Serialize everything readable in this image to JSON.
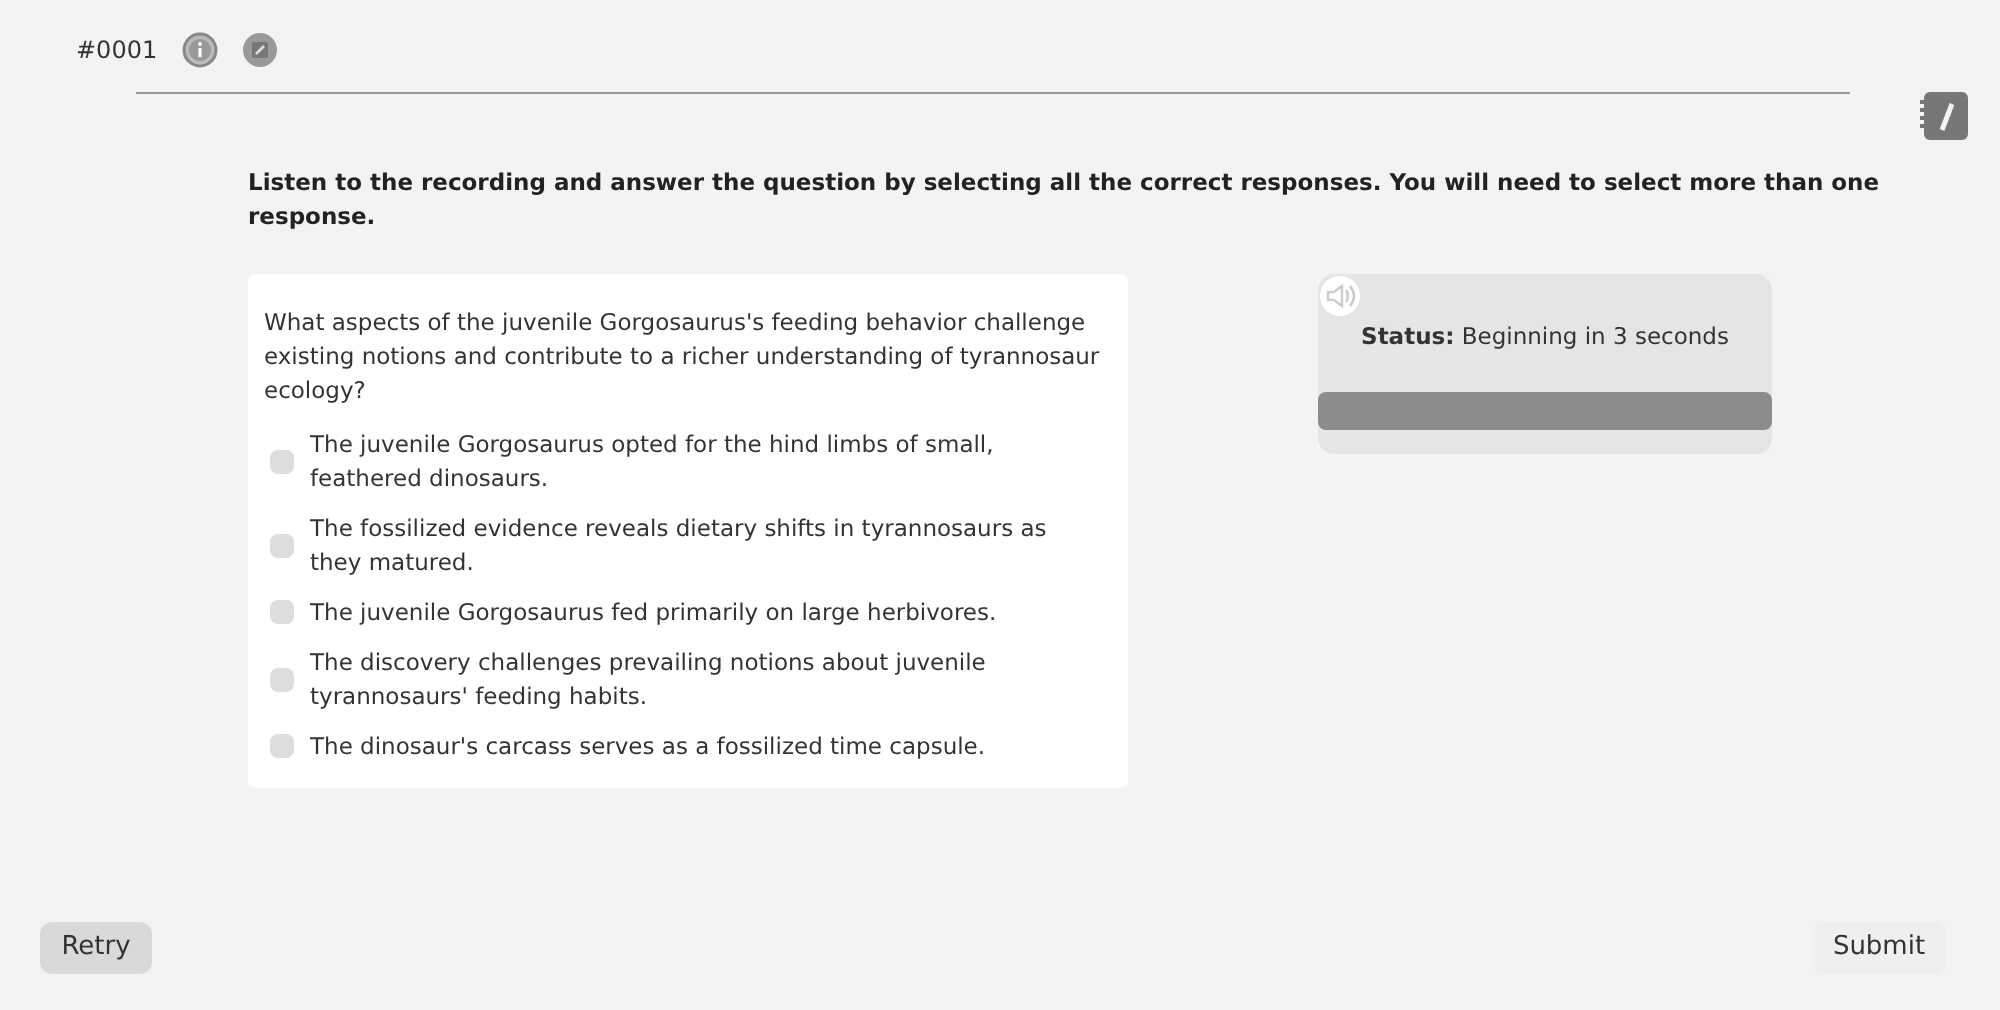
{
  "header": {
    "item_number": "#0001"
  },
  "instruction": "Listen to the recording and answer the question by selecting all the correct responses. You will need to select more than one response.",
  "question": {
    "prompt": "What aspects of the juvenile Gorgosaurus's feeding behavior challenge existing notions and contribute to a richer understanding of tyrannosaur ecology?",
    "options": [
      {
        "label": "The juvenile Gorgosaurus opted for the hind limbs of small, feathered dinosaurs.",
        "checked": false
      },
      {
        "label": "The fossilized evidence reveals dietary shifts in tyrannosaurs as they matured.",
        "checked": false
      },
      {
        "label": "The juvenile Gorgosaurus fed primarily on large herbivores.",
        "checked": false
      },
      {
        "label": "The discovery challenges prevailing notions about juvenile tyrannosaurs' feeding habits.",
        "checked": false
      },
      {
        "label": "The dinosaur's carcass serves as a fossilized time capsule.",
        "checked": false
      }
    ]
  },
  "audio": {
    "status_label": "Status:",
    "status_text": "Beginning in 3 seconds"
  },
  "buttons": {
    "retry": "Retry",
    "submit": "Submit"
  }
}
